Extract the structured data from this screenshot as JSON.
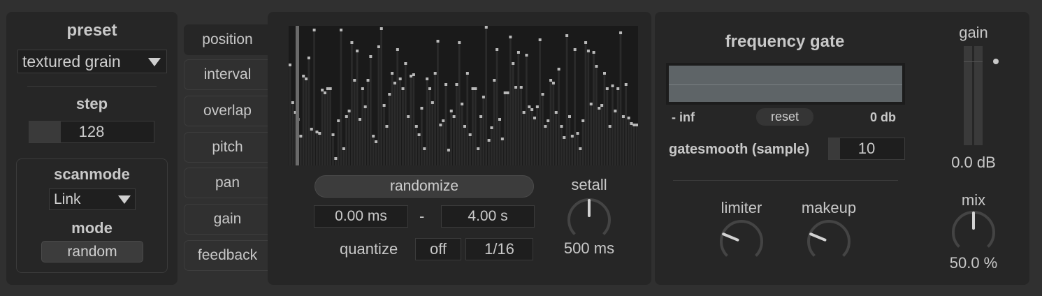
{
  "preset": {
    "title": "preset",
    "selected": "textured grain",
    "step_label": "step",
    "step_value": "128",
    "scanmode_label": "scanmode",
    "scanmode_value": "Link",
    "mode_label": "mode",
    "mode_value": "random"
  },
  "tabs": [
    {
      "label": "position",
      "active": true
    },
    {
      "label": "interval",
      "active": false
    },
    {
      "label": "overlap",
      "active": false
    },
    {
      "label": "pitch",
      "active": false
    },
    {
      "label": "pan",
      "active": false
    },
    {
      "label": "gain",
      "active": false
    },
    {
      "label": "feedback",
      "active": false
    }
  ],
  "sequencer": {
    "step_values": [
      0.72,
      0.45,
      0.38,
      0.33,
      0.21,
      0.64,
      0.62,
      0.77,
      0.26,
      0.97,
      0.24,
      0.23,
      0.54,
      0.52,
      0.55,
      0.55,
      0.22,
      0.05,
      0.32,
      0.97,
      0.12,
      0.35,
      0.39,
      0.88,
      0.61,
      0.82,
      0.33,
      0.55,
      0.42,
      0.61,
      0.78,
      0.21,
      0.17,
      0.85,
      0.98,
      0.43,
      0.28,
      0.51,
      0.66,
      0.59,
      0.83,
      0.62,
      0.55,
      0.73,
      0.35,
      0.64,
      0.65,
      0.28,
      0.22,
      0.41,
      0.12,
      0.62,
      0.55,
      0.45,
      0.66,
      0.89,
      0.29,
      0.32,
      0.58,
      0.11,
      0.39,
      0.35,
      0.58,
      0.88,
      0.44,
      0.28,
      0.66,
      0.22,
      0.55,
      0.55,
      0.12,
      0.35,
      0.49,
      0.99,
      0.18,
      0.27,
      0.61,
      0.83,
      0.33,
      0.19,
      0.52,
      0.52,
      0.92,
      0.73,
      0.56,
      0.81,
      0.56,
      0.38,
      0.79,
      0.42,
      0.4,
      0.34,
      0.42,
      0.9,
      0.51,
      0.28,
      0.32,
      0.61,
      0.59,
      0.38,
      0.69,
      0.28,
      0.2,
      0.93,
      0.35,
      0.21,
      0.83,
      0.23,
      0.12,
      0.32,
      0.88,
      0.82,
      0.44,
      0.81,
      0.71,
      0.41,
      0.43,
      0.66,
      0.55,
      0.28,
      0.57,
      0.39,
      0.55,
      0.95,
      0.35,
      0.58,
      0.34,
      0.3,
      0.29,
      0.29
    ],
    "randomize_label": "randomize",
    "range_min": "0.00 ms",
    "range_sep": "-",
    "range_max": "4.00 s",
    "quantize_label": "quantize",
    "quantize_state": "off",
    "quantize_value": "1/16",
    "setall_label": "setall",
    "setall_value": "500 ms",
    "setall_level": 0.5
  },
  "gate": {
    "title": "frequency gate",
    "min_label": "- inf",
    "reset_label": "reset",
    "max_label": "0 db",
    "smooth_label": "gatesmooth (sample)",
    "smooth_value": "10",
    "limiter_label": "limiter",
    "limiter_level": 0.25,
    "makeup_label": "makeup",
    "makeup_level": 0.25
  },
  "output": {
    "gain_label": "gain",
    "gain_value": "0.0 dB",
    "mix_label": "mix",
    "mix_value": "50.0 %",
    "mix_level": 0.5
  },
  "colors": {
    "background": "#303030",
    "panel": "#262626",
    "accent": "#c8c8c8"
  }
}
